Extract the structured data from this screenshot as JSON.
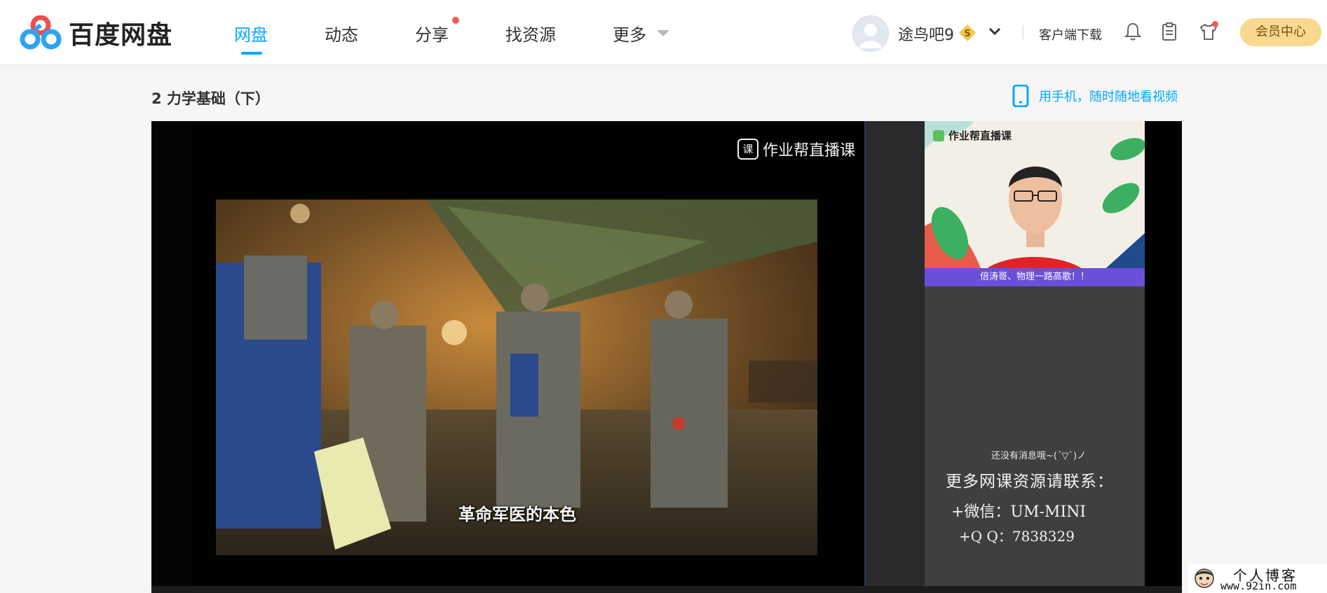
{
  "app": {
    "name": "百度网盘"
  },
  "nav": {
    "items": [
      {
        "label": "网盘",
        "active": true
      },
      {
        "label": "动态"
      },
      {
        "label": "分享",
        "badge": true
      },
      {
        "label": "找资源"
      },
      {
        "label": "更多",
        "dropdown": true
      }
    ]
  },
  "user": {
    "name": "途鸟吧9",
    "vip_icon": "coin-s-icon"
  },
  "header_actions": {
    "download": "客户端下载",
    "icons": [
      "bell-icon",
      "clipboard-icon",
      "shirt-icon"
    ],
    "member_center": "会员中心"
  },
  "page": {
    "title": "2 力学基础（下）",
    "mobile_link": "用手机，随时随地看视频"
  },
  "video": {
    "watermark": "作业帮直播课",
    "subtitle": "革命军医的本色",
    "camera_brand": "作业帮直播课",
    "camera_banner": "倍涛哥、物理一路高歌！！",
    "chat_empty": "还没有消息哦~(ˊ▽ˋ)ノ",
    "promo": {
      "line1": "更多网课资源请联系：",
      "line2": "+微信：UM-MINI",
      "line3": "+Q Q：7838329"
    }
  },
  "site_watermark": {
    "line1": "个人博客",
    "line2": "www.92in.com"
  },
  "colors": {
    "accent": "#06a7ff",
    "member_btn": "#f8d98f",
    "badge_red": "#f25a5a"
  }
}
